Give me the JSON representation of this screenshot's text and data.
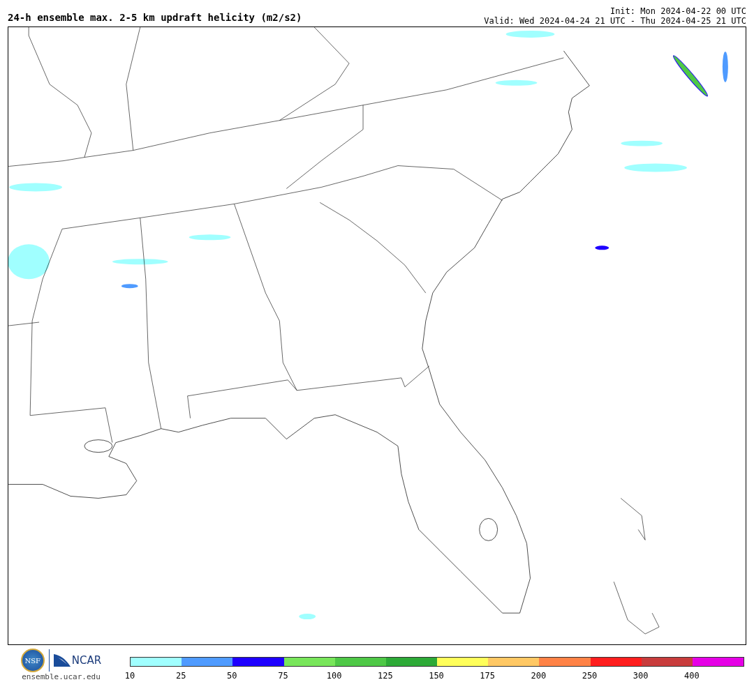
{
  "title": "24-h ensemble max. 2-5 km updraft helicity (m2/s2)",
  "init": "Init: Mon 2024-04-22 00 UTC",
  "valid": "Valid: Wed 2024-04-24 21 UTC - Thu 2024-04-25 21 UTC",
  "logos": {
    "nsf": "NSF",
    "ncar": "NCAR",
    "site": "ensemble.ucar.edu"
  },
  "legend": {
    "bins": [
      {
        "color": "#a0ffff"
      },
      {
        "color": "#4f9bff"
      },
      {
        "color": "#1e00ff"
      },
      {
        "color": "#78e65a"
      },
      {
        "color": "#4ec846"
      },
      {
        "color": "#2daa37"
      },
      {
        "color": "#ffff5a"
      },
      {
        "color": "#ffc864"
      },
      {
        "color": "#ff8246"
      },
      {
        "color": "#ff1e1e"
      },
      {
        "color": "#c83c3c"
      },
      {
        "color": "#e600e6"
      }
    ],
    "ticks": [
      "10",
      "25",
      "50",
      "75",
      "100",
      "125",
      "150",
      "175",
      "200",
      "250",
      "300",
      "400"
    ]
  }
}
